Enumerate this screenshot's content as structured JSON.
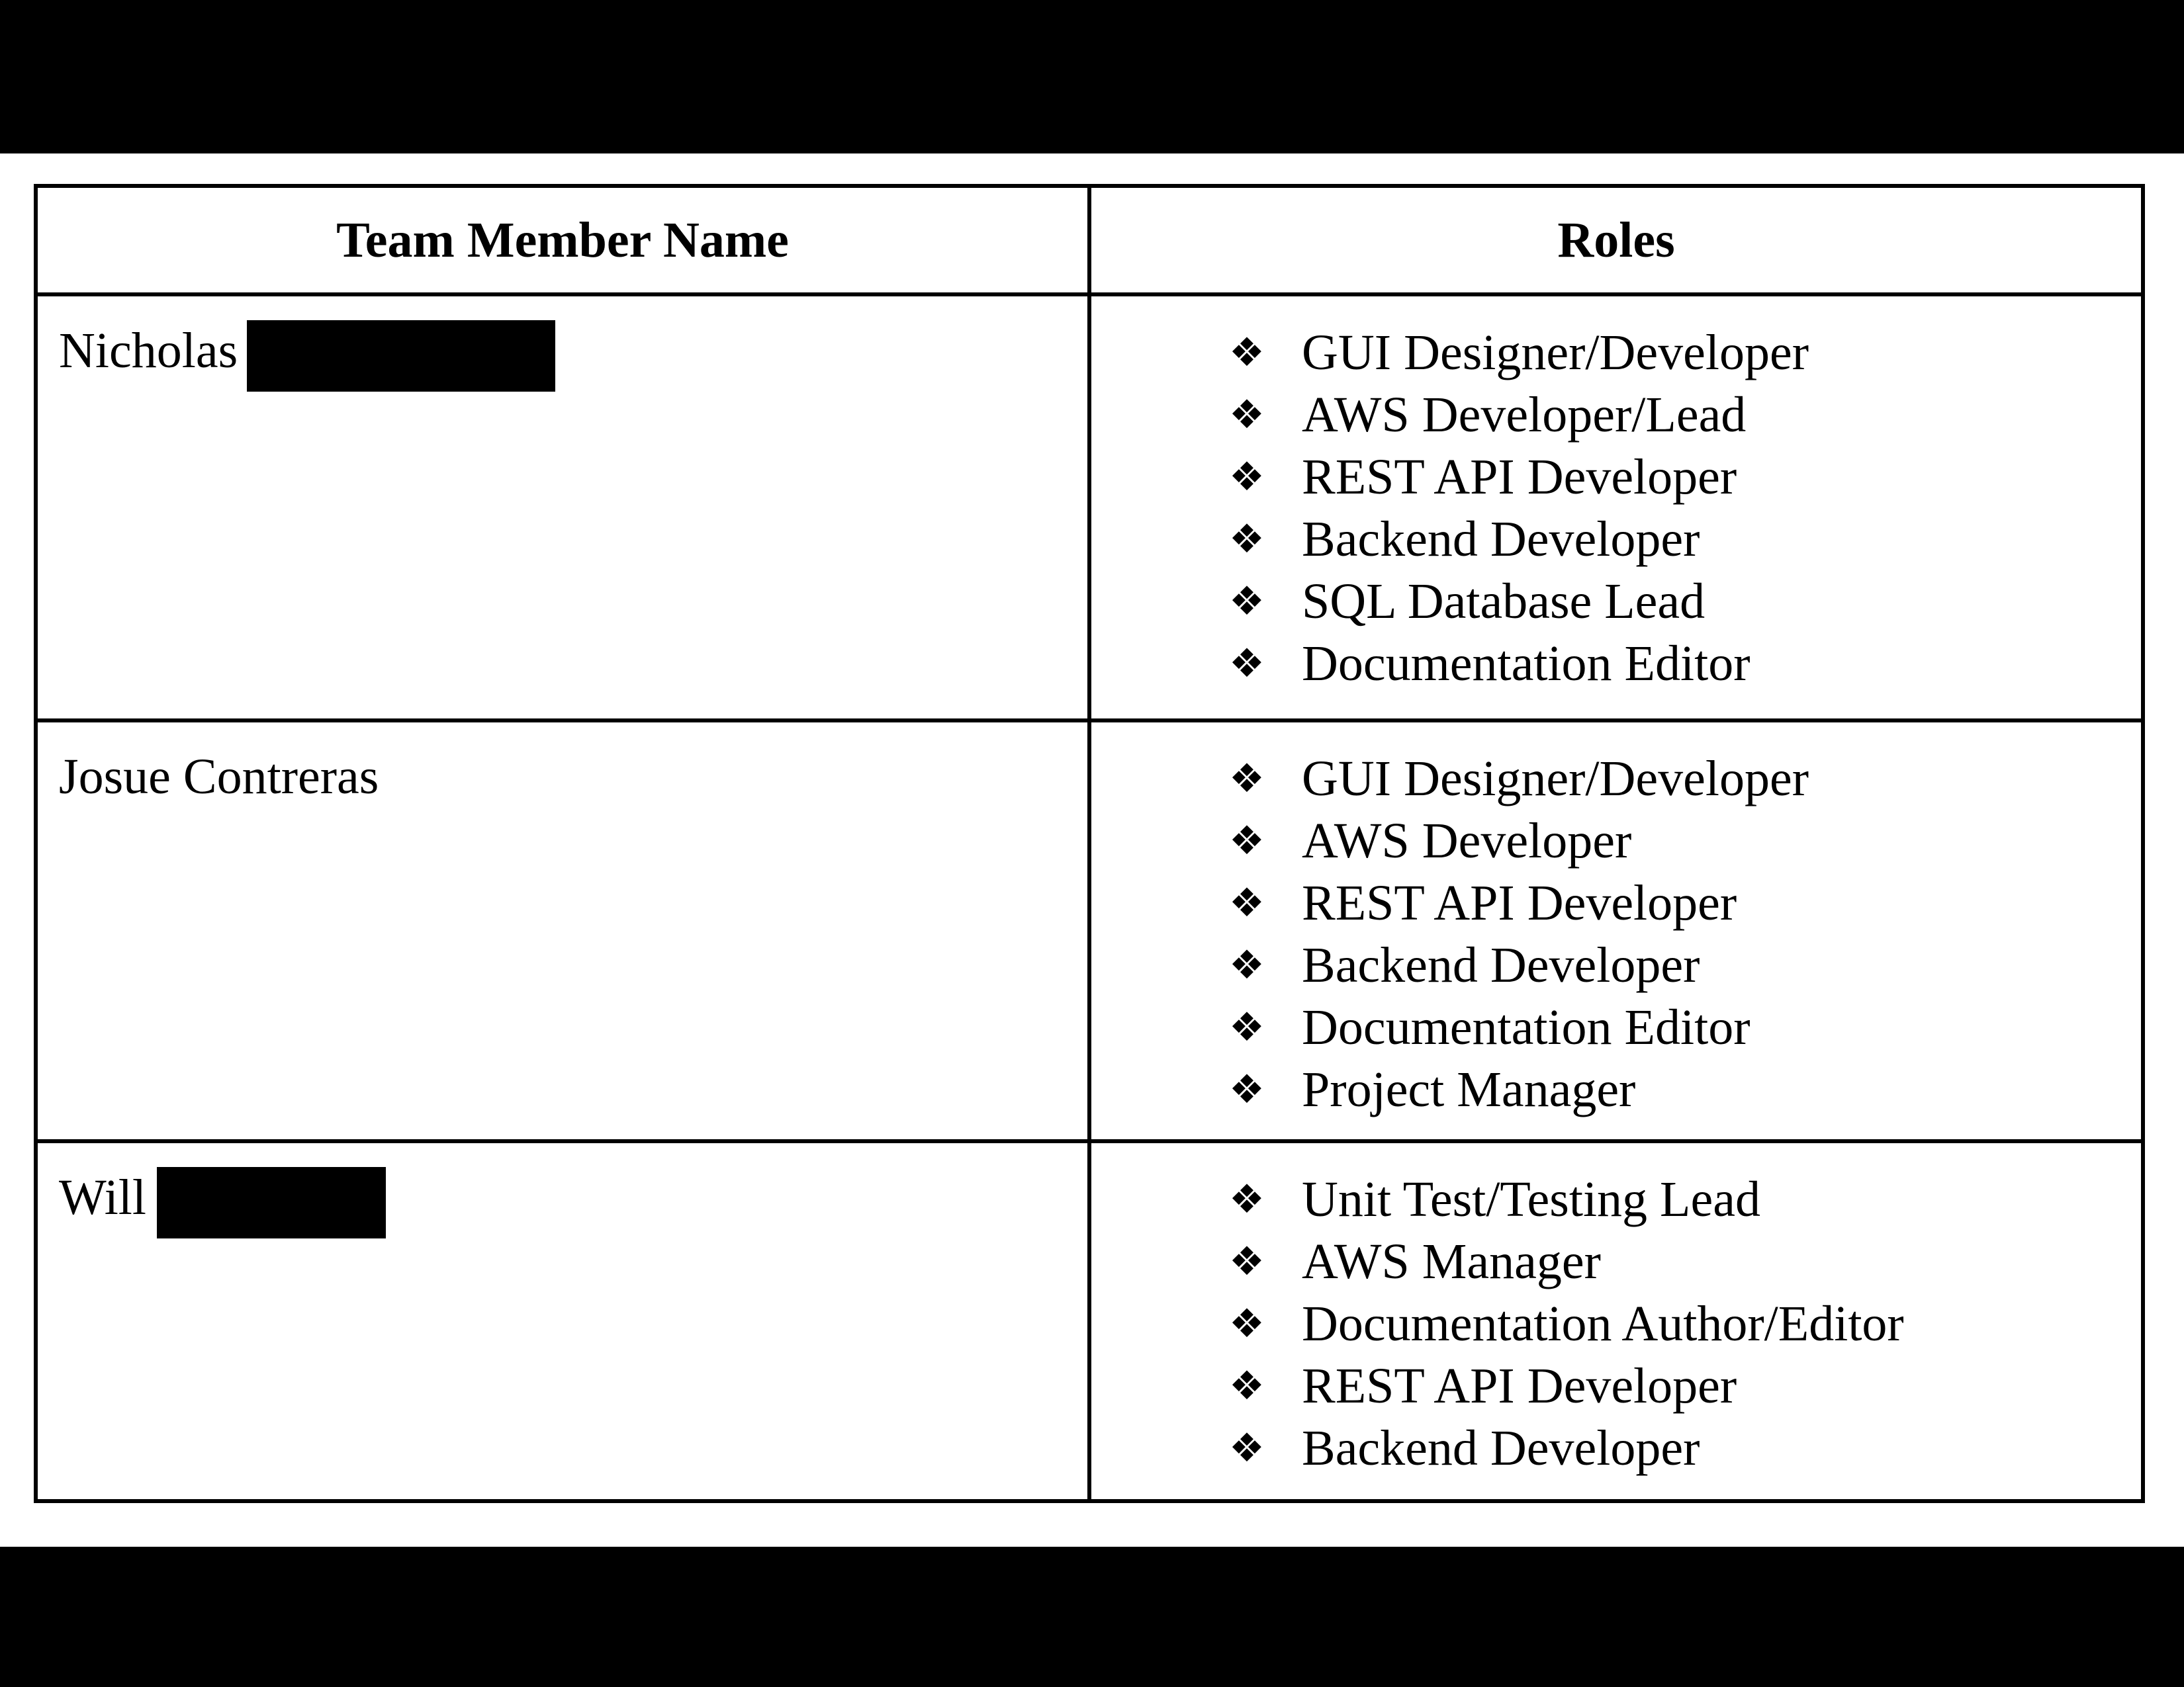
{
  "table": {
    "headers": {
      "name": "Team Member Name",
      "roles": "Roles"
    },
    "members": [
      {
        "name": "Nicholas",
        "roles": [
          "GUI Designer/Developer",
          "AWS Developer/Lead",
          "REST API Developer",
          "Backend Developer",
          "SQL Database Lead",
          "Documentation Editor"
        ]
      },
      {
        "name": "Josue Contreras",
        "roles": [
          "GUI Designer/Developer",
          "AWS Developer",
          "REST API Developer",
          "Backend Developer",
          "Documentation Editor",
          "Project Manager"
        ]
      },
      {
        "name": "Will",
        "roles": [
          "Unit Test/Testing Lead",
          "AWS Manager",
          "Documentation Author/Editor",
          "REST API Developer",
          "Backend Developer"
        ]
      }
    ]
  },
  "bullet_glyph": "❖",
  "colors": {
    "background": "#000000",
    "page": "#ffffff",
    "text": "#000000",
    "redaction": "#000000"
  }
}
